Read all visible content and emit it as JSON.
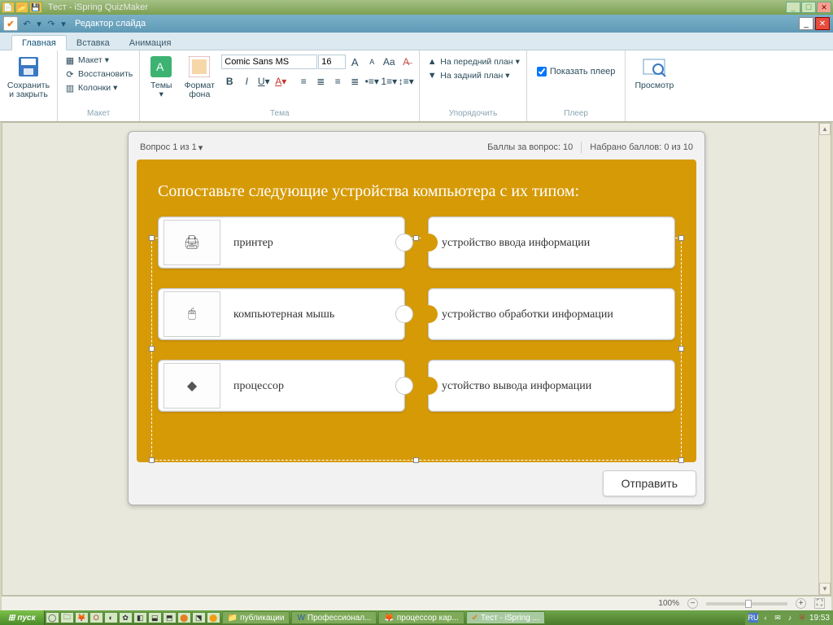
{
  "window": {
    "title": "Тест - iSpring QuizMaker",
    "subtitle": "Редактор слайда"
  },
  "tabs": {
    "main": "Главная",
    "insert": "Вставка",
    "anim": "Анимация"
  },
  "ribbon": {
    "save_close": "Сохранить\nи закрыть",
    "layout": "Макет",
    "restore": "Восстановить",
    "columns": "Колонки",
    "group_layout": "Макет",
    "themes": "Темы",
    "bg_format": "Формат\nфона",
    "group_theme": "Тема",
    "font": "Comic Sans MS",
    "size": "16",
    "bring_front": "На передний план",
    "send_back": "На задний план",
    "group_arrange": "Упорядочить",
    "show_player": "Показать плеер",
    "group_player": "Плеер",
    "preview": "Просмотр"
  },
  "slide": {
    "counter": "Вопрос 1 из 1",
    "points": "Баллы за вопрос: 10",
    "scored": "Набрано баллов: 0 из 10",
    "question": "Сопоставьте следующие устройства  компьютера с их типом:",
    "left_items": [
      {
        "label": "принтер"
      },
      {
        "label": "компьютерная мышь"
      },
      {
        "label": "процессор"
      }
    ],
    "right_items": [
      {
        "label": "устройство ввода информации"
      },
      {
        "label": "устройство обработки информации"
      },
      {
        "label": "устойство вывода информации"
      }
    ],
    "submit": "Отправить"
  },
  "status": {
    "zoom": "100%"
  },
  "taskbar": {
    "start": "пуск",
    "tasks": [
      "публикации",
      "Профессионал...",
      "процессор кар...",
      "Тест - iSpring ..."
    ],
    "lang": "RU",
    "time": "19:53"
  }
}
